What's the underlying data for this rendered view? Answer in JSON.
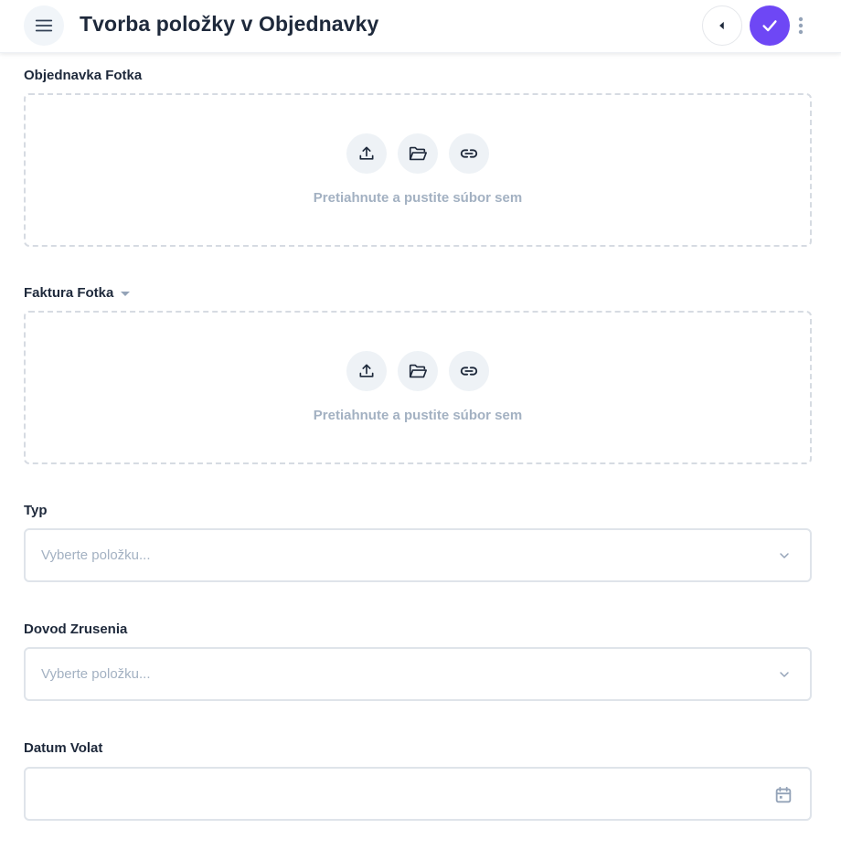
{
  "header": {
    "title": "Tvorba položky v Objednavky",
    "menu_icon": "hamburger-menu-icon",
    "back_icon": "caret-left-icon",
    "save_icon": "check-icon",
    "more_icon": "vertical-dots-icon"
  },
  "colors": {
    "accent": "#6e47f5",
    "text": "#1e293b",
    "muted": "#a3b1c2",
    "border": "#dfe4ea"
  },
  "fields": {
    "objednavka_fotka": {
      "label": "Objednavka Fotka",
      "dropzone_text": "Pretiahnute a pustite súbor sem",
      "icons": [
        "upload-icon",
        "folder-open-icon",
        "link-icon"
      ]
    },
    "faktura_fotka": {
      "label": "Faktura Fotka",
      "dropzone_text": "Pretiahnute a pustite súbor sem",
      "icons": [
        "upload-icon",
        "folder-open-icon",
        "link-icon"
      ]
    },
    "typ": {
      "label": "Typ",
      "placeholder": "Vyberte položku..."
    },
    "dovod_zrusenia": {
      "label": "Dovod Zrusenia",
      "placeholder": "Vyberte položku..."
    },
    "datum_volat": {
      "label": "Datum Volat",
      "value": "",
      "icon": "calendar-icon"
    }
  }
}
